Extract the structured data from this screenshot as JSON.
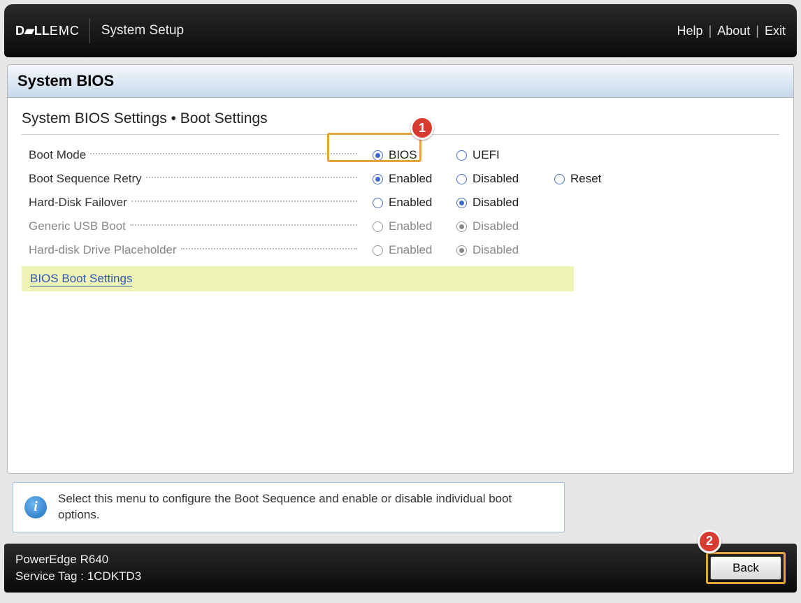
{
  "topbar": {
    "brand_bold": "D▰LL",
    "brand_light": "EMC",
    "title": "System Setup",
    "links": {
      "help": "Help",
      "about": "About",
      "exit": "Exit"
    }
  },
  "panel": {
    "title": "System BIOS",
    "breadcrumb": "System BIOS Settings • Boot Settings"
  },
  "settings": [
    {
      "key": "boot_mode",
      "label": "Boot Mode",
      "disabled": false,
      "options": [
        {
          "label": "BIOS",
          "selected": true,
          "col": "a"
        },
        {
          "label": "UEFI",
          "selected": false,
          "col": "b"
        }
      ]
    },
    {
      "key": "boot_sequence_retry",
      "label": "Boot Sequence Retry",
      "disabled": false,
      "options": [
        {
          "label": "Enabled",
          "selected": true,
          "col": "a"
        },
        {
          "label": "Disabled",
          "selected": false,
          "col": "b"
        },
        {
          "label": "Reset",
          "selected": false,
          "col": "c"
        }
      ]
    },
    {
      "key": "hard_disk_failover",
      "label": "Hard-Disk Failover",
      "disabled": false,
      "options": [
        {
          "label": "Enabled",
          "selected": false,
          "col": "a"
        },
        {
          "label": "Disabled",
          "selected": true,
          "col": "b"
        }
      ]
    },
    {
      "key": "generic_usb_boot",
      "label": "Generic USB Boot",
      "disabled": true,
      "options": [
        {
          "label": "Enabled",
          "selected": false,
          "col": "a"
        },
        {
          "label": "Disabled",
          "selected": true,
          "col": "b"
        }
      ]
    },
    {
      "key": "hard_disk_drive_placeholder",
      "label": "Hard-disk Drive Placeholder",
      "disabled": true,
      "options": [
        {
          "label": "Enabled",
          "selected": false,
          "col": "a"
        },
        {
          "label": "Disabled",
          "selected": true,
          "col": "b"
        }
      ]
    }
  ],
  "submenu": {
    "label": "BIOS Boot Settings"
  },
  "info": {
    "text": "Select this menu to configure the Boot Sequence and enable or disable individual boot options."
  },
  "footer": {
    "model": "PowerEdge R640",
    "service_tag_label": "Service Tag :",
    "service_tag_value": "1CDKTD3",
    "back_label": "Back"
  },
  "callouts": {
    "one": "1",
    "two": "2"
  }
}
